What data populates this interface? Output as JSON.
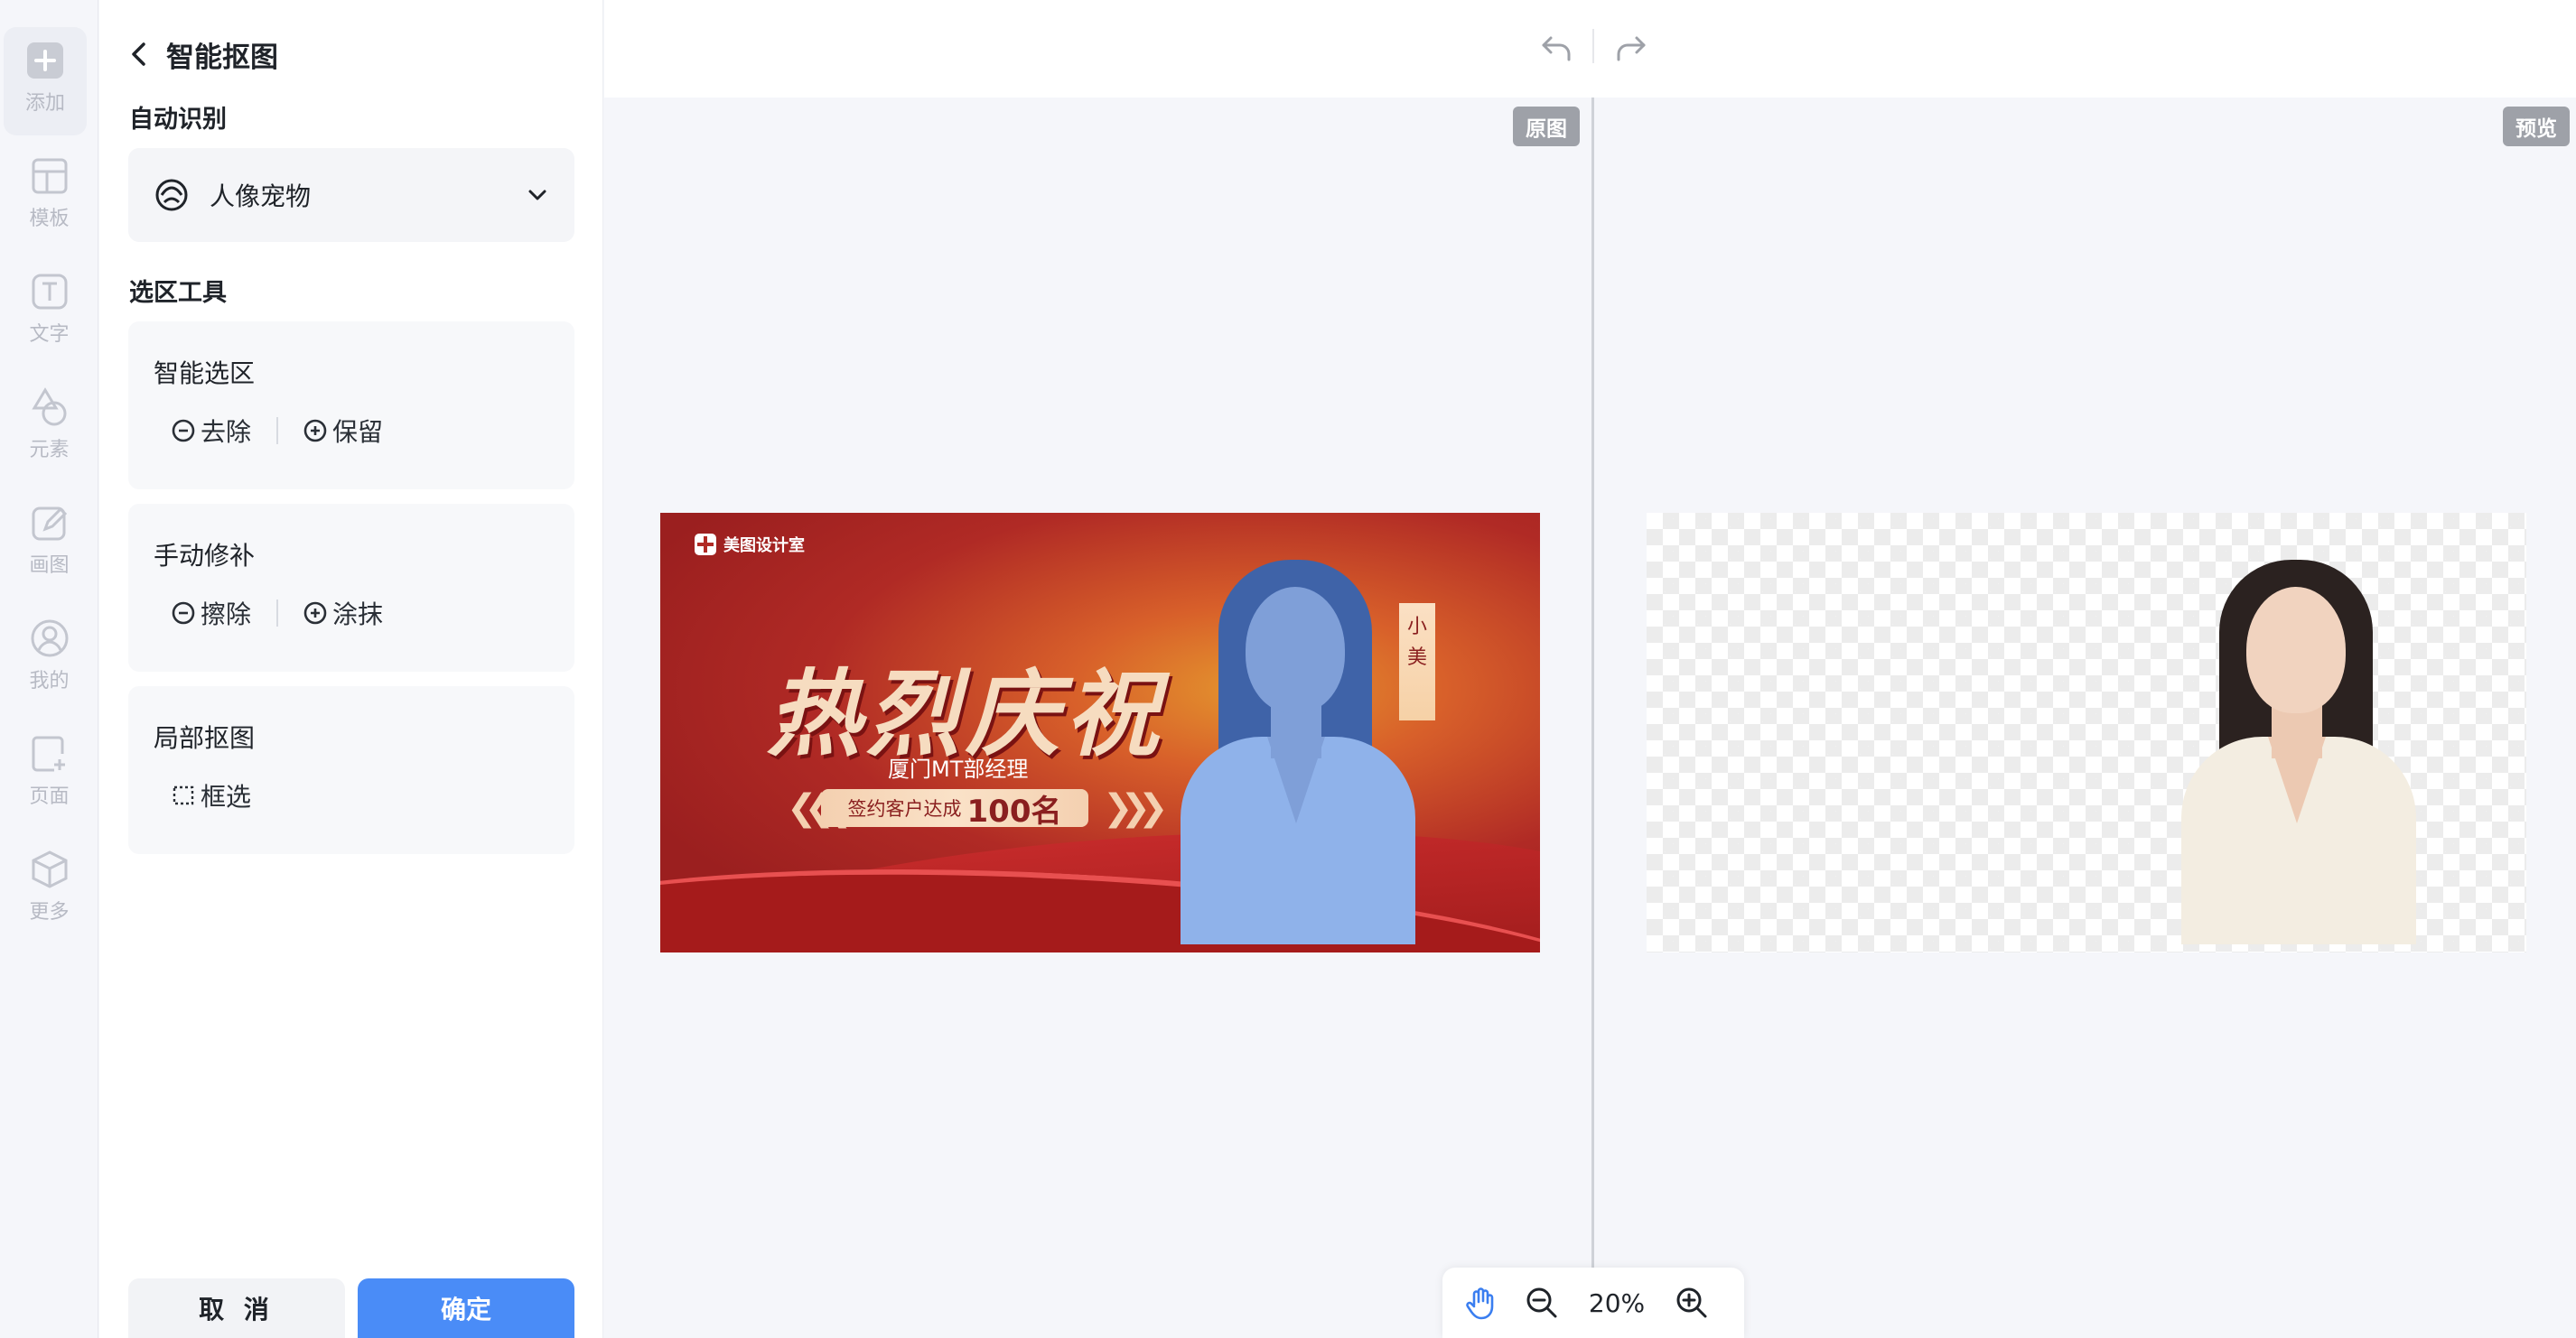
{
  "rail": {
    "items": [
      {
        "label": "添加",
        "icon": "plus-icon"
      },
      {
        "label": "模板",
        "icon": "template-icon"
      },
      {
        "label": "文字",
        "icon": "text-icon"
      },
      {
        "label": "元素",
        "icon": "shapes-icon"
      },
      {
        "label": "画图",
        "icon": "draw-icon"
      },
      {
        "label": "我的",
        "icon": "user-icon"
      },
      {
        "label": "页面",
        "icon": "page-icon"
      },
      {
        "label": "更多",
        "icon": "cube-icon"
      }
    ]
  },
  "panel": {
    "title": "智能抠图",
    "auto_label": "自动识别",
    "auto_select_value": "人像宠物",
    "tools_label": "选区工具",
    "smart": {
      "title": "智能选区",
      "remove": "去除",
      "keep": "保留"
    },
    "manual": {
      "title": "手动修补",
      "erase": "擦除",
      "paint": "涂抹"
    },
    "local": {
      "title": "局部抠图",
      "box": "框选"
    },
    "cancel": "取 消",
    "confirm": "确定"
  },
  "canvas": {
    "original_tag": "原图",
    "preview_tag": "预览",
    "zoom": "20%"
  },
  "banner": {
    "brand": "美图设计室",
    "headline": "热烈庆祝",
    "subline": "厦门MT部经理",
    "pill_text": "签约客户达成",
    "pill_number": "100名",
    "name_tag": [
      "小",
      "美"
    ]
  },
  "colors": {
    "accent": "#4a8cf7",
    "banner_red": "#b02a25",
    "selection_blue": "#8fb2ea"
  }
}
